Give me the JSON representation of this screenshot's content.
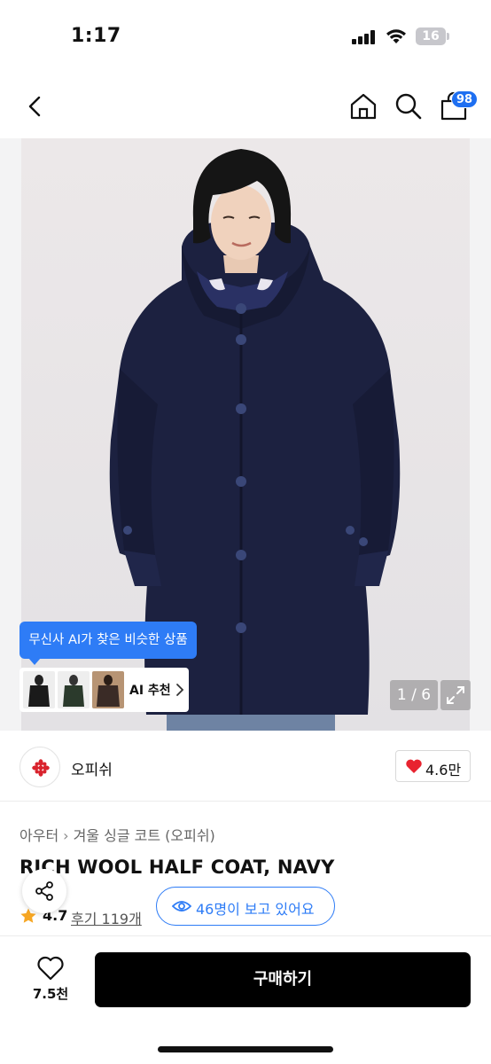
{
  "status_bar": {
    "time": "1:17",
    "battery": "16"
  },
  "nav": {
    "cart_count": "98"
  },
  "ai_recommend": {
    "tooltip": "무신사 AI가 찾은 비슷한 상품",
    "label": "AI 추천"
  },
  "image": {
    "counter": "1 / 6"
  },
  "brand": {
    "name": "오피쉬",
    "likes": "4.6만"
  },
  "breadcrumb": {
    "category": "아우터",
    "subcategory": "겨울 싱글 코트 (오피쉬)"
  },
  "product": {
    "title": "RICH WOOL HALF COAT, NAVY",
    "rating": "4.7",
    "reviews": "후기 119개"
  },
  "viewers": {
    "text": "46명이 보고 있어요"
  },
  "bottom": {
    "wish_count": "7.5천",
    "buy_label": "구매하기"
  },
  "colors": {
    "accent": "#2e7cf6",
    "badge": "#1e6ff1",
    "heart": "#e8232f",
    "star": "#f6a623",
    "coat": "#1c2140"
  }
}
